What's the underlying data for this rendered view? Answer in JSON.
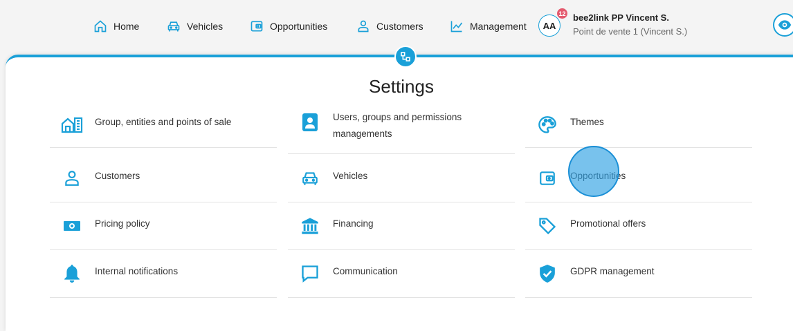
{
  "nav": {
    "home": "Home",
    "vehicles": "Vehicles",
    "opportunities": "Opportunities",
    "customers": "Customers",
    "management": "Management"
  },
  "user": {
    "initials": "AA",
    "notifications": "12",
    "name": "bee2link PP Vincent S.",
    "point_of_sale": "Point de vente 1 (Vincent S.)"
  },
  "page": {
    "title": "Settings"
  },
  "settings": {
    "group": "Group, entities and points of sale",
    "users": "Users, groups and permissions managements",
    "themes": "Themes",
    "customers": "Customers",
    "vehicles": "Vehicles",
    "opportunities": "Opportunities",
    "pricing": "Pricing policy",
    "financing": "Financing",
    "promotional": "Promotional offers",
    "notifications": "Internal notifications",
    "communication": "Communication",
    "gdpr": "GDPR management"
  },
  "colors": {
    "accent": "#1aa0d8",
    "badge": "#e45a6e"
  }
}
